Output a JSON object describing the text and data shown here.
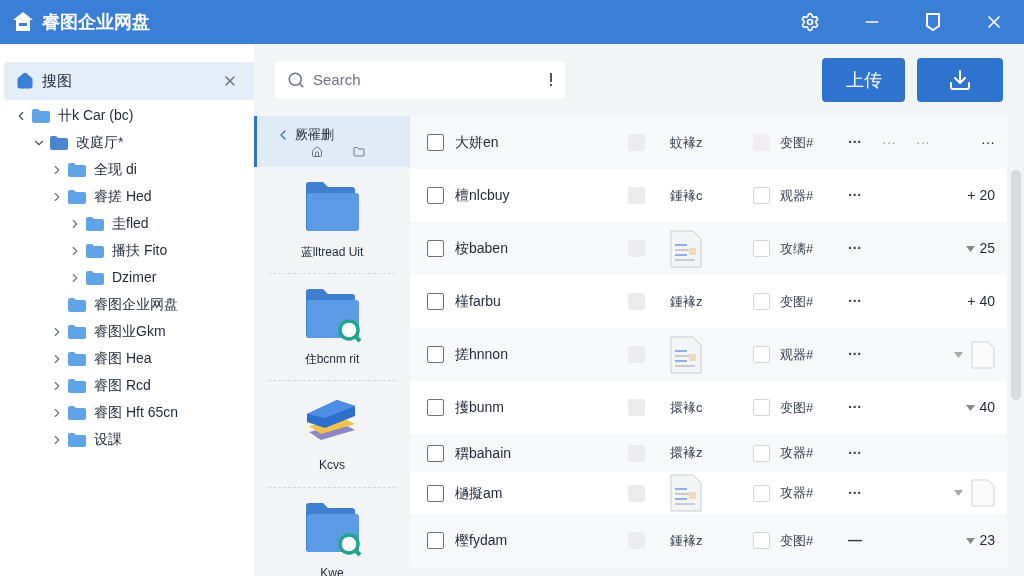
{
  "window": {
    "title": "睿图企业网盘"
  },
  "sidebar": {
    "header": "搜图",
    "tree": [
      {
        "label": "卄k Car (bc)",
        "expanded": true,
        "children": [
          {
            "label": "改庭厅*",
            "expanded": true,
            "children": [
              {
                "label": "全现 di",
                "expanded": false
              },
              {
                "label": "睿搓 Hed",
                "expanded": false,
                "children": [
                  {
                    "label": "圭fled",
                    "expanded": false
                  },
                  {
                    "label": "播扶 Fito",
                    "expanded": false
                  },
                  {
                    "label": "Dzimer",
                    "expanded": false
                  }
                ]
              },
              {
                "label": "睿图企业网盘"
              },
              {
                "label": "睿图业Gkm",
                "expanded": false
              },
              {
                "label": "睿图 Hea",
                "expanded": false
              },
              {
                "label": "睿图 Rcd",
                "expanded": false
              },
              {
                "label": "睿图 Hft 65cn",
                "expanded": false
              },
              {
                "label": "设課",
                "expanded": false
              }
            ]
          }
        ]
      }
    ]
  },
  "search": {
    "placeholder": "Search"
  },
  "toolbar": {
    "upload": "上传"
  },
  "places": [
    {
      "label": "厥罹删",
      "kind": "back",
      "selected": true
    },
    {
      "label": "蓝lltread Uit",
      "kind": "folder",
      "selected": false
    },
    {
      "label": "住bcnm rit",
      "kind": "folder-search",
      "selected": false
    },
    {
      "label": "Kcvs",
      "kind": "stack",
      "selected": false
    },
    {
      "label": "Kwe",
      "kind": "folder-search",
      "selected": false
    }
  ],
  "rows": [
    {
      "name": "大姘en",
      "checked": false,
      "type": {
        "kind": "text",
        "text": "蚊褖z"
      },
      "tag": "变图#",
      "action": "···",
      "extra": [
        "···",
        "···"
      ],
      "trend": {
        "kind": "text",
        "value": "···"
      }
    },
    {
      "name": "檀nlcbuy",
      "checked": false,
      "type": {
        "kind": "text",
        "text": "鍾褖c"
      },
      "tag_checkbox": {
        "checked": false
      },
      "tag": "观器#",
      "action": "···",
      "trend": {
        "kind": "text",
        "value": "+ 20"
      }
    },
    {
      "name": "桉baben",
      "checked": false,
      "type": {
        "kind": "file"
      },
      "tag_checkbox": {
        "checked": false
      },
      "tag": "攻缡#",
      "action": "···",
      "trend": {
        "kind": "down",
        "value": "25"
      }
    },
    {
      "name": "槿farbu",
      "checked": false,
      "type": {
        "kind": "text",
        "text": "鍾褖z"
      },
      "tag_checkbox": {
        "checked": false
      },
      "tag": "变图#",
      "action": "···",
      "trend": {
        "kind": "text",
        "value": "+ 40"
      }
    },
    {
      "name": "搓hnnon",
      "checked": false,
      "type": {
        "kind": "file"
      },
      "tag_checkbox": {
        "checked": false
      },
      "tag": "观器#",
      "action": "···",
      "trend": {
        "kind": "doc"
      }
    },
    {
      "name": "擭bunm",
      "checked": false,
      "type": {
        "kind": "text",
        "text": "擐褖c"
      },
      "tag_checkbox": {
        "checked": false
      },
      "tag": "变图#",
      "action": "···",
      "trend": {
        "kind": "down",
        "value": "40"
      }
    },
    {
      "name": "穓bahain",
      "checked": false,
      "type": {
        "kind": "text",
        "text": "擐褖z"
      },
      "tag_checkbox": {
        "checked": false
      },
      "tag": "攻器#",
      "action": "···"
    },
    {
      "name": "檛擬am",
      "checked": false,
      "type": {
        "kind": "file"
      },
      "tag_checkbox": {
        "checked": false
      },
      "tag": "攻器#",
      "action": "···",
      "trend": {
        "kind": "doc"
      }
    },
    {
      "name": "樫fydam",
      "checked": false,
      "type": {
        "kind": "text",
        "text": "鍾褖z"
      },
      "tag_checkbox": {
        "checked": false
      },
      "tag": "变图#",
      "action": "—",
      "trend": {
        "kind": "down",
        "value": "23"
      }
    }
  ]
}
